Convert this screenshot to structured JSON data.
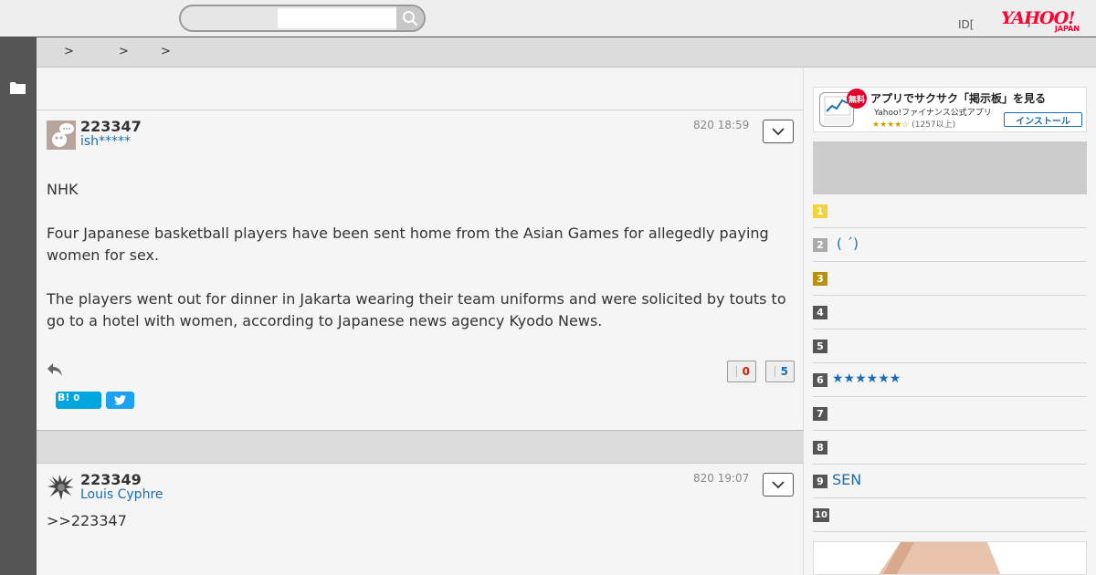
{
  "header": {
    "search_placeholder": "",
    "id_label": "ID[",
    "bracket_label": "]",
    "logo_top": "YAHOO!",
    "logo_bottom": "JAPAN"
  },
  "breadcrumb": [
    ">",
    ">",
    ">"
  ],
  "posts": [
    {
      "number": "223347",
      "author": "ish*****",
      "date": "820 18:59",
      "body": [
        "NHK",
        "Four Japanese basketball players have been sent home from the Asian Games for allegedly paying women for sex.",
        "The players went out for dinner in Jakarta wearing their team uniforms and were solicited by touts to go to a hotel with women, according to Japanese news agency Kyodo News."
      ],
      "votes_down": "0",
      "votes_up": "5",
      "hatena_label": "B!",
      "hatena_count": "0"
    },
    {
      "number": "223349",
      "author": "Louis Cyphre",
      "date": "820 19:07",
      "body": [
        ">>223347"
      ]
    }
  ],
  "app_banner": {
    "badge": "無料",
    "title": "アプリでサクサク「掲示板」を見る",
    "subtitle": "Yahoo!ファイナンス公式アプリ",
    "stars": "★★★★☆",
    "rating_count": "(1257以上)",
    "install_label": "インストール"
  },
  "ranking": [
    {
      "rank": "1",
      "text": "",
      "color": "#f3d23c"
    },
    {
      "rank": "2",
      "text": "( ´)",
      "color": "#aaaaaa"
    },
    {
      "rank": "3",
      "text": "",
      "color": "#b8900c"
    },
    {
      "rank": "4",
      "text": "",
      "color": "#555555"
    },
    {
      "rank": "5",
      "text": "",
      "color": "#555555"
    },
    {
      "rank": "6",
      "text": "★★★★★★",
      "color": "#555555"
    },
    {
      "rank": "7",
      "text": "",
      "color": "#555555"
    },
    {
      "rank": "8",
      "text": "",
      "color": "#555555"
    },
    {
      "rank": "9",
      "text": "SEN",
      "color": "#555555"
    },
    {
      "rank": "10",
      "text": "",
      "color": "#555555"
    }
  ],
  "colors": {
    "link": "#1a6db5",
    "vote_down": "#cc2200",
    "vote_up": "#1a6db5",
    "yahoo_red": "#ff0033"
  }
}
